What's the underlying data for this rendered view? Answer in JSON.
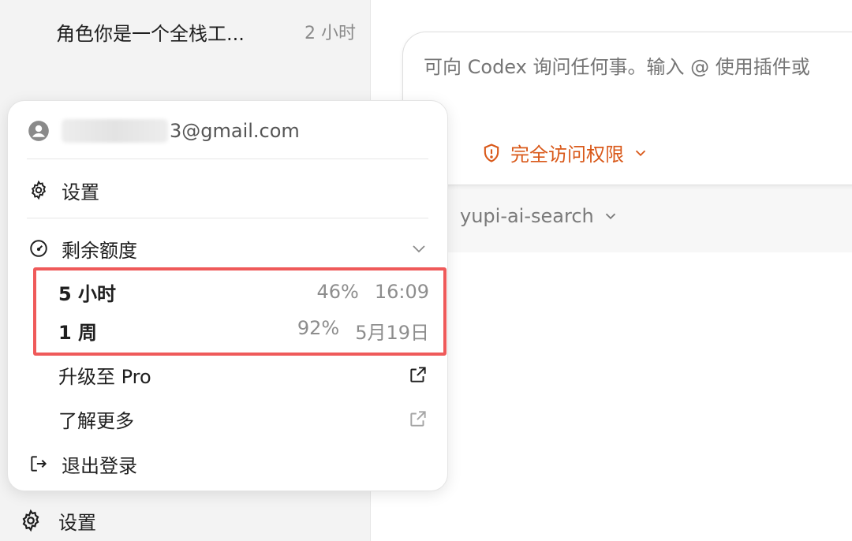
{
  "sidebar": {
    "thread": {
      "title": "角色你是一个全栈工...",
      "time": "2 小时"
    },
    "settings_label": "设置"
  },
  "composer": {
    "placeholder": "可向 Codex 询问任何事。输入 @ 使用插件或",
    "access_label": "完全访问权限",
    "branch_label": "yupi-ai-search",
    "accent_color": "#d9591a"
  },
  "menu": {
    "account_email": "3@gmail.com",
    "settings_label": "设置",
    "quota_label": "剩余额度",
    "quotas": [
      {
        "label": "5 小时",
        "percent": "46%",
        "reset": "16:09"
      },
      {
        "label": "1 周",
        "percent": "92%",
        "reset": "5月19日"
      }
    ],
    "upgrade_label": "升级至 Pro",
    "learn_more_label": "了解更多",
    "logout_label": "退出登录"
  },
  "colors": {
    "highlight_border": "#ef5a5a",
    "sidebar_bg": "#f3f3f3"
  }
}
